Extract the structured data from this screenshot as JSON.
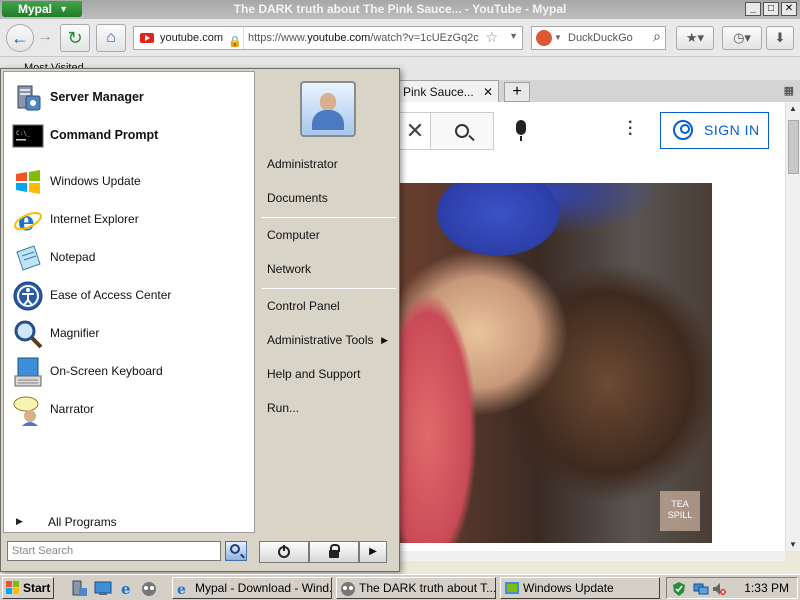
{
  "browser": {
    "app_button": "Mypal",
    "window_title": "The DARK truth about The Pink Sauce... - YouTube - Mypal",
    "site_identity": "youtube.com",
    "url_prefix": "https://www.",
    "url_host": "youtube.com",
    "url_rest": "/watch?v=1cUEzGq2c",
    "search_placeholder": "DuckDuckGo",
    "bookmark_folder": "Most Visited",
    "active_tab": "Pink Sauce...",
    "window_controls": {
      "minimize": "_",
      "maximize": "□",
      "close": "✕"
    }
  },
  "page": {
    "signin_label": "SIGN IN",
    "watermark_text": "TEA SPILL"
  },
  "start_menu": {
    "pinned": [
      {
        "label": "Server Manager",
        "icon": "server-manager-icon"
      },
      {
        "label": "Command Prompt",
        "icon": "command-prompt-icon"
      }
    ],
    "recent": [
      {
        "label": "Windows Update",
        "icon": "windows-update-icon"
      },
      {
        "label": "Internet Explorer",
        "icon": "internet-explorer-icon"
      },
      {
        "label": "Notepad",
        "icon": "notepad-icon"
      },
      {
        "label": "Ease of Access Center",
        "icon": "ease-of-access-icon"
      },
      {
        "label": "Magnifier",
        "icon": "magnifier-icon"
      },
      {
        "label": "On-Screen Keyboard",
        "icon": "on-screen-keyboard-icon"
      },
      {
        "label": "Narrator",
        "icon": "narrator-icon"
      }
    ],
    "all_programs": "All Programs",
    "search_placeholder": "Start Search",
    "right": {
      "user": "Administrator",
      "documents": "Documents",
      "computer": "Computer",
      "network": "Network",
      "control_panel": "Control Panel",
      "admin_tools": "Administrative Tools",
      "help": "Help and Support",
      "run": "Run..."
    }
  },
  "taskbar": {
    "start_label": "Start",
    "tasks": [
      "Mypal - Download - Wind...",
      "The DARK truth about T...",
      "Windows Update"
    ],
    "clock": "1:33 PM"
  }
}
